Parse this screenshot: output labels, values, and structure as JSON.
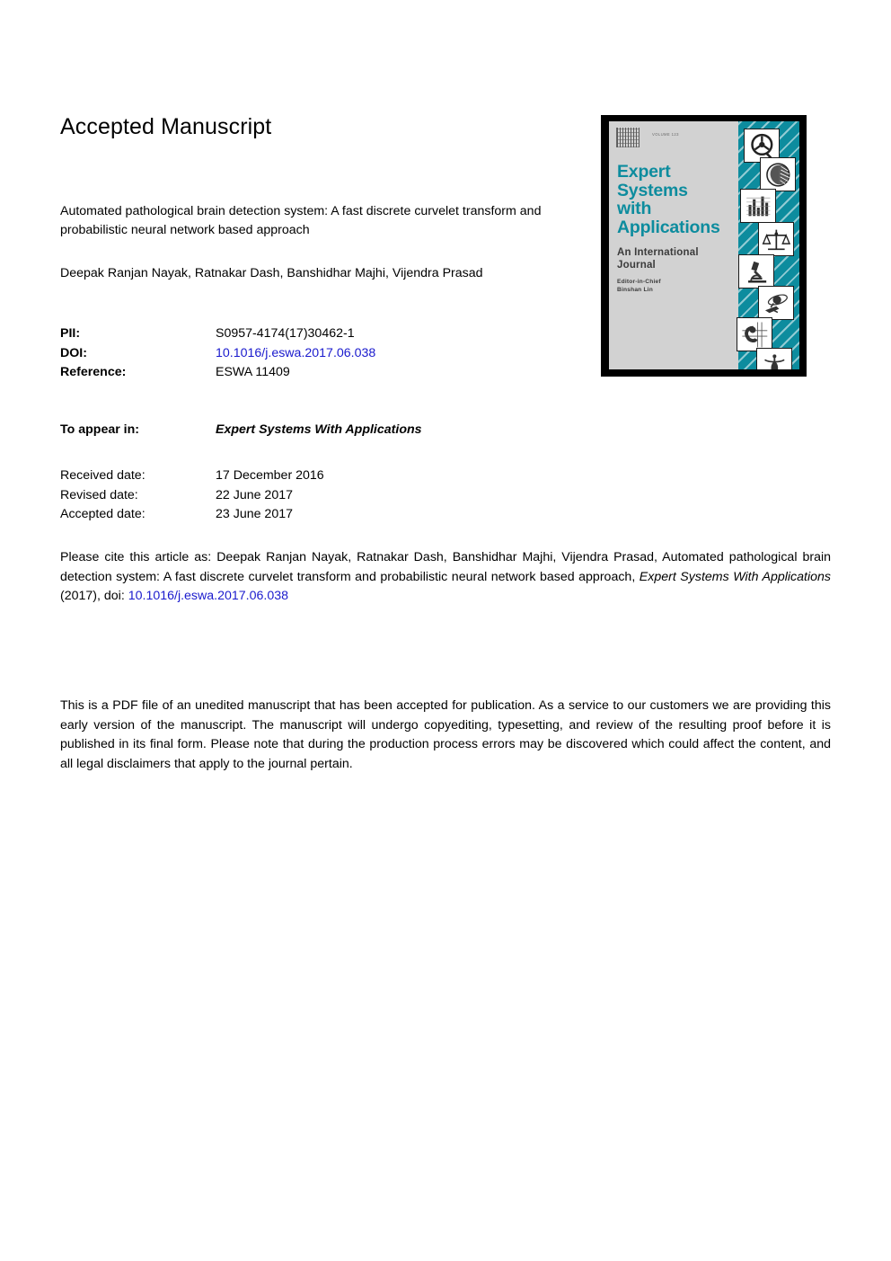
{
  "page": {
    "header_title": "Accepted Manuscript",
    "background": "#ffffff",
    "link_color": "#1a1acd",
    "accent_color": "#0d8c9e"
  },
  "article": {
    "title": "Automated pathological brain detection system: A fast discrete curvelet transform and probabilistic neural network based approach",
    "authors": "Deepak Ranjan Nayak, Ratnakar Dash, Banshidhar Majhi, Vijendra Prasad"
  },
  "identifiers": {
    "pii_label": "PII:",
    "pii_value": "S0957-4174(17)30462-1",
    "doi_label": "DOI:",
    "doi_value": "10.1016/j.eswa.2017.06.038",
    "reference_label": "Reference:",
    "reference_value": "ESWA 11409"
  },
  "publication": {
    "to_appear_label": "To appear in:",
    "to_appear_value": "Expert Systems With Applications"
  },
  "dates": {
    "received_label": "Received date:",
    "received_value": "17 December 2016",
    "revised_label": "Revised date:",
    "revised_value": "22 June 2017",
    "accepted_label": "Accepted date:",
    "accepted_value": "23 June 2017"
  },
  "citation": {
    "prefix": "Please cite this article as: Deepak Ranjan Nayak, Ratnakar Dash, Banshidhar Majhi, Vijendra Prasad, Automated pathological brain detection system: A fast discrete curvelet transform and probabilistic neural network based approach, ",
    "journal": "Expert Systems With Applications",
    "middle": " (2017), doi: ",
    "doi": "10.1016/j.eswa.2017.06.038"
  },
  "disclaimer": {
    "text": "This is a PDF file of an unedited manuscript that has been accepted for publication. As a service to our customers we are providing this early version of the manuscript. The manuscript will undergo copyediting, typesetting, and review of the resulting proof before it is published in its final form. Please note that during the production process errors may be discovered which could affect the content, and all legal disclaimers that apply to the journal pertain."
  },
  "journal_cover": {
    "volume_text": "VOLUME 123",
    "title_line1": "Expert",
    "title_line2": "Systems",
    "title_line3": "with",
    "title_line4": "Applications",
    "subtitle_line1": "An International",
    "subtitle_line2": "Journal",
    "editor_line1": "Editor-in-Chief",
    "editor_line2": "Binshan Lin",
    "background_color": "#d2d2d2",
    "panel_color": "#0d8c9e",
    "title_color": "#0d8c9e",
    "icons": [
      "steering-wheel-icon",
      "head-profile-icon",
      "bar-chart-icon",
      "scales-of-justice-icon",
      "microscope-icon",
      "planet-space-icon",
      "circuit-industry-icon",
      "caduceus-medical-icon"
    ]
  }
}
